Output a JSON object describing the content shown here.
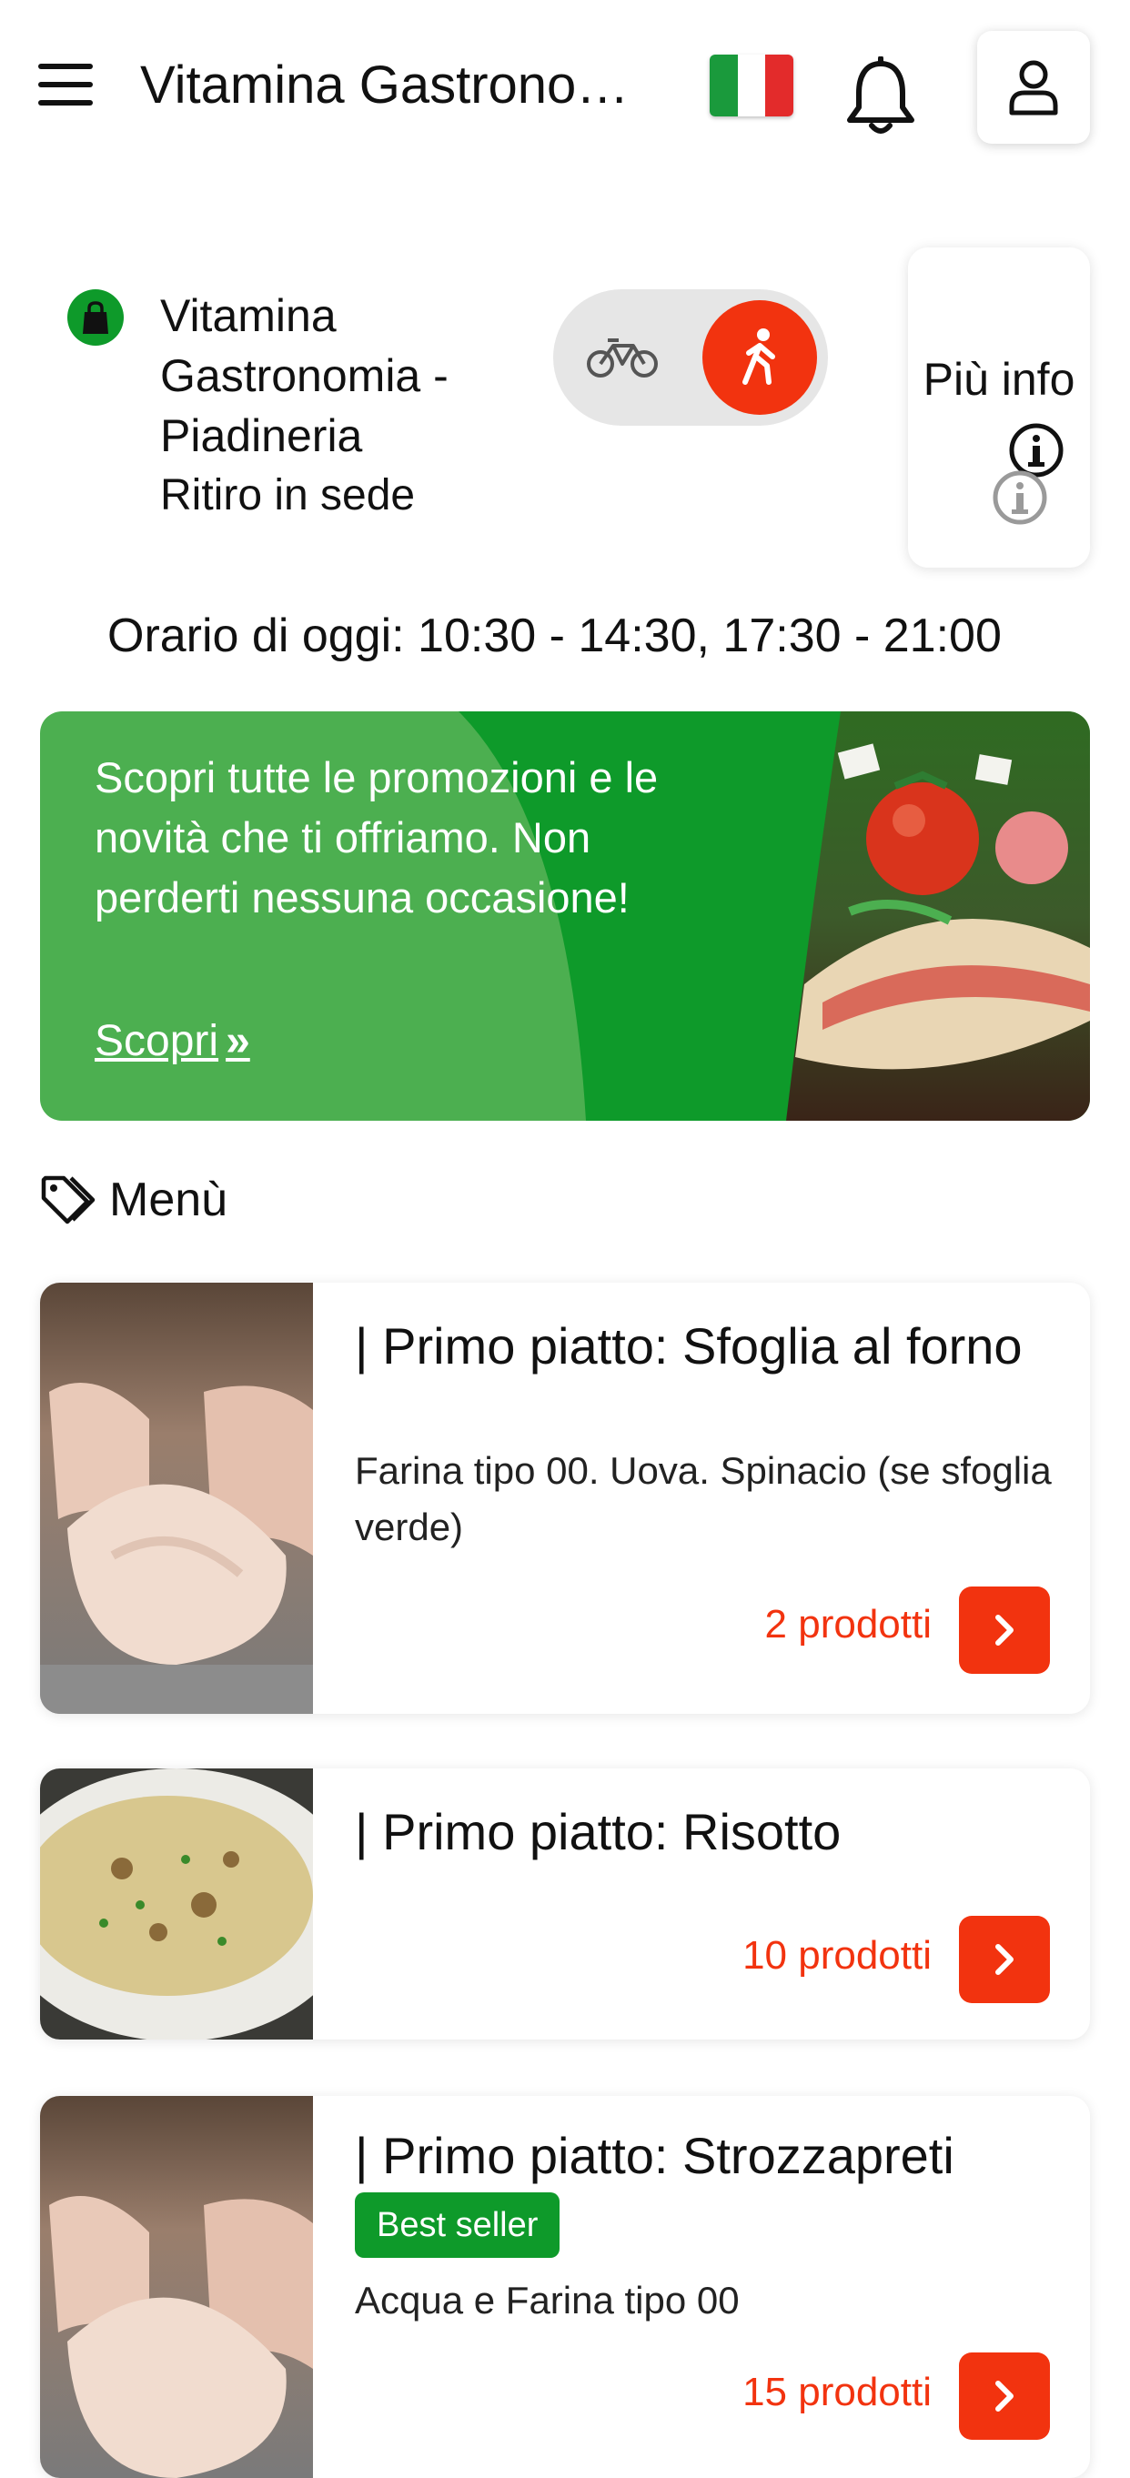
{
  "header": {
    "title": "Vitamina Gastronomi…",
    "flag_colors": [
      "#1a9a3c",
      "#ffffff",
      "#e32b2b"
    ],
    "icons": [
      "menu-icon",
      "italy-flag-icon",
      "bell-icon",
      "user-icon"
    ]
  },
  "store": {
    "name": "Vitamina Gastronomia - Piadineria",
    "mode_label": "Ritiro in sede",
    "info_label": "Più info",
    "hours": "Orario di oggi: 10:30 - 14:30, 17:30 - 21:00"
  },
  "promo": {
    "text": "Scopri tutte le promozioni e le novità che ti offriamo. Non perderti nessuna occasione!",
    "link_label": "Scopri"
  },
  "menu": {
    "heading": "Menù",
    "categories": [
      {
        "title": "| Primo piatto: Sfoglia al forno",
        "description": "Farina tipo 00. Uova. Spinacio (se sfoglia verde)",
        "count": "2 prodotti"
      },
      {
        "title": "| Primo piatto: Risotto",
        "description": "",
        "count": "10 prodotti"
      },
      {
        "title": "| Primo piatto: Strozzapreti",
        "badge": "Best seller",
        "description": "Acqua e Farina tipo 00",
        "count": "15 prodotti"
      }
    ]
  },
  "colors": {
    "accent": "#f2330f",
    "green": "#0e9a2a",
    "promo_green": "#4caf50"
  }
}
